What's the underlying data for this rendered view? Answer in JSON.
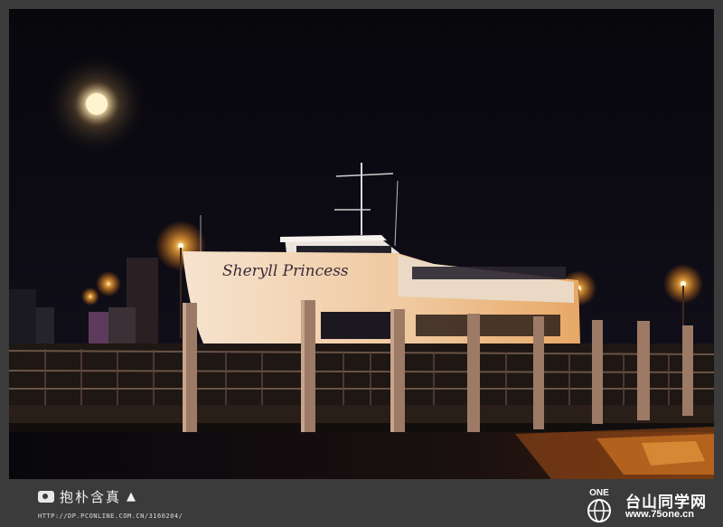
{
  "photo": {
    "subject": "moored-ferry-at-night",
    "boat_name": "Sheryll Princess",
    "colors": {
      "sky": "#0b0a12",
      "moon": "#fff4cf",
      "light_glow": "#ff9a2a",
      "hull": "#f3d7b8",
      "water_reflection": "#e8761a"
    }
  },
  "footer": {
    "credit_text": "抱朴含真",
    "credit_url": "HTTP://DP.PCONLINE.COM.CN/3160204/",
    "logo_mark": "ONE",
    "logo_title": "台山同学网",
    "logo_url": "www.75one.cn"
  }
}
